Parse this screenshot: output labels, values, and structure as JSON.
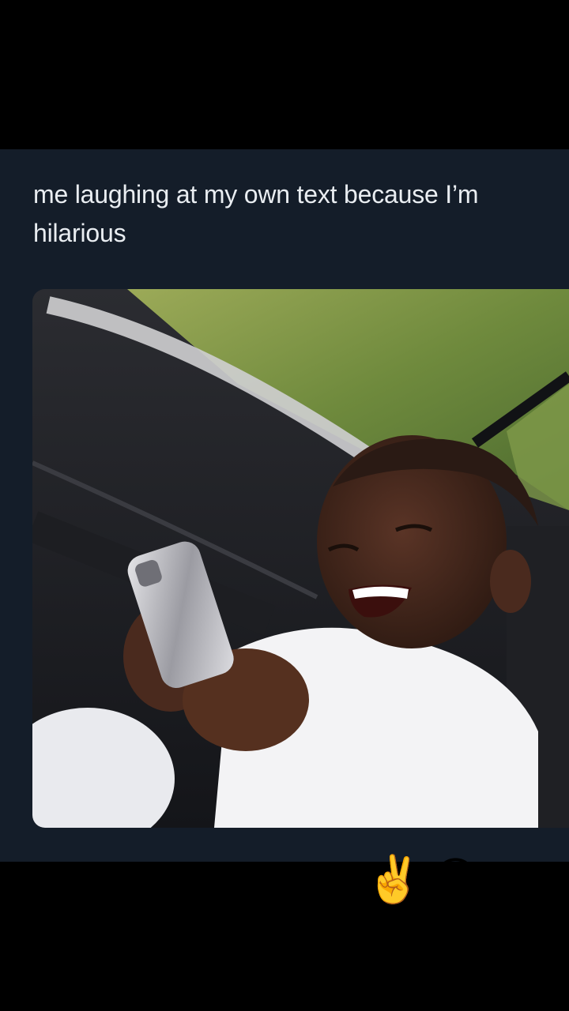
{
  "post": {
    "text": "me laughing at my own text because I’m hilarious",
    "media": {
      "icon": "photo-laughing-child-icon"
    }
  },
  "caption": {
    "emojis": [
      "✌️",
      "😝"
    ]
  },
  "colors": {
    "background": "#000000",
    "card": "#141d29",
    "text": "#e9edf1"
  }
}
